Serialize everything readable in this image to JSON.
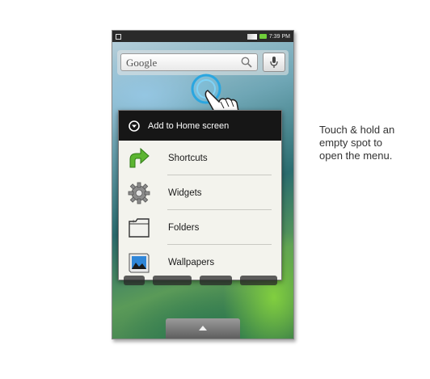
{
  "status_bar": {
    "time": "7:39 PM"
  },
  "search_widget": {
    "label": "Google"
  },
  "menu": {
    "title": "Add to Home screen",
    "items": [
      {
        "label": "Shortcuts",
        "icon": "shortcut-arrow-icon"
      },
      {
        "label": "Widgets",
        "icon": "gear-icon"
      },
      {
        "label": "Folders",
        "icon": "folder-icon"
      },
      {
        "label": "Wallpapers",
        "icon": "wallpaper-icon"
      }
    ]
  },
  "caption": {
    "lines": [
      "Touch & hold an",
      "empty spot to",
      "open the menu."
    ]
  }
}
